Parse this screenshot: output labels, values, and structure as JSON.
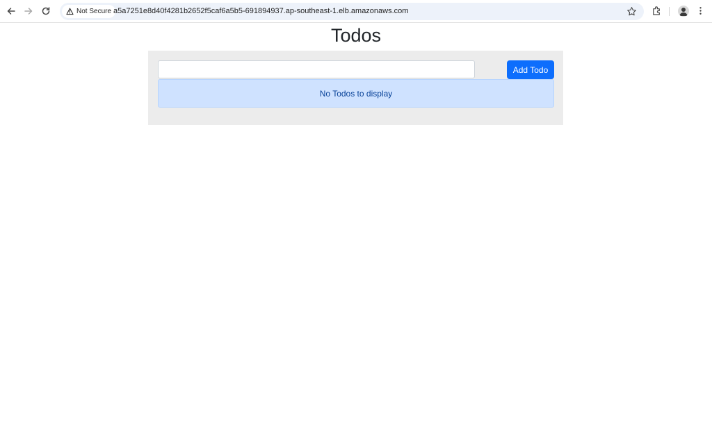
{
  "browser": {
    "security_label": "Not Secure",
    "url": "a5a7251e8d40f4281b2652f5caf6a5b5-691894937.ap-southeast-1.elb.amazonaws.com",
    "icons": [
      "back-arrow-icon",
      "forward-arrow-icon",
      "reload-icon",
      "warning-icon",
      "star-icon",
      "extensions-icon",
      "avatar",
      "more-menu-icon"
    ]
  },
  "page": {
    "title": "Todos",
    "input": {
      "value": "",
      "placeholder": ""
    },
    "add_button_label": "Add Todo",
    "empty_message": "No Todos to display"
  },
  "colors": {
    "accent": "#0d6efd",
    "panel_bg": "#ececec",
    "alert_bg": "#cfe2ff",
    "alert_text": "#084298"
  }
}
